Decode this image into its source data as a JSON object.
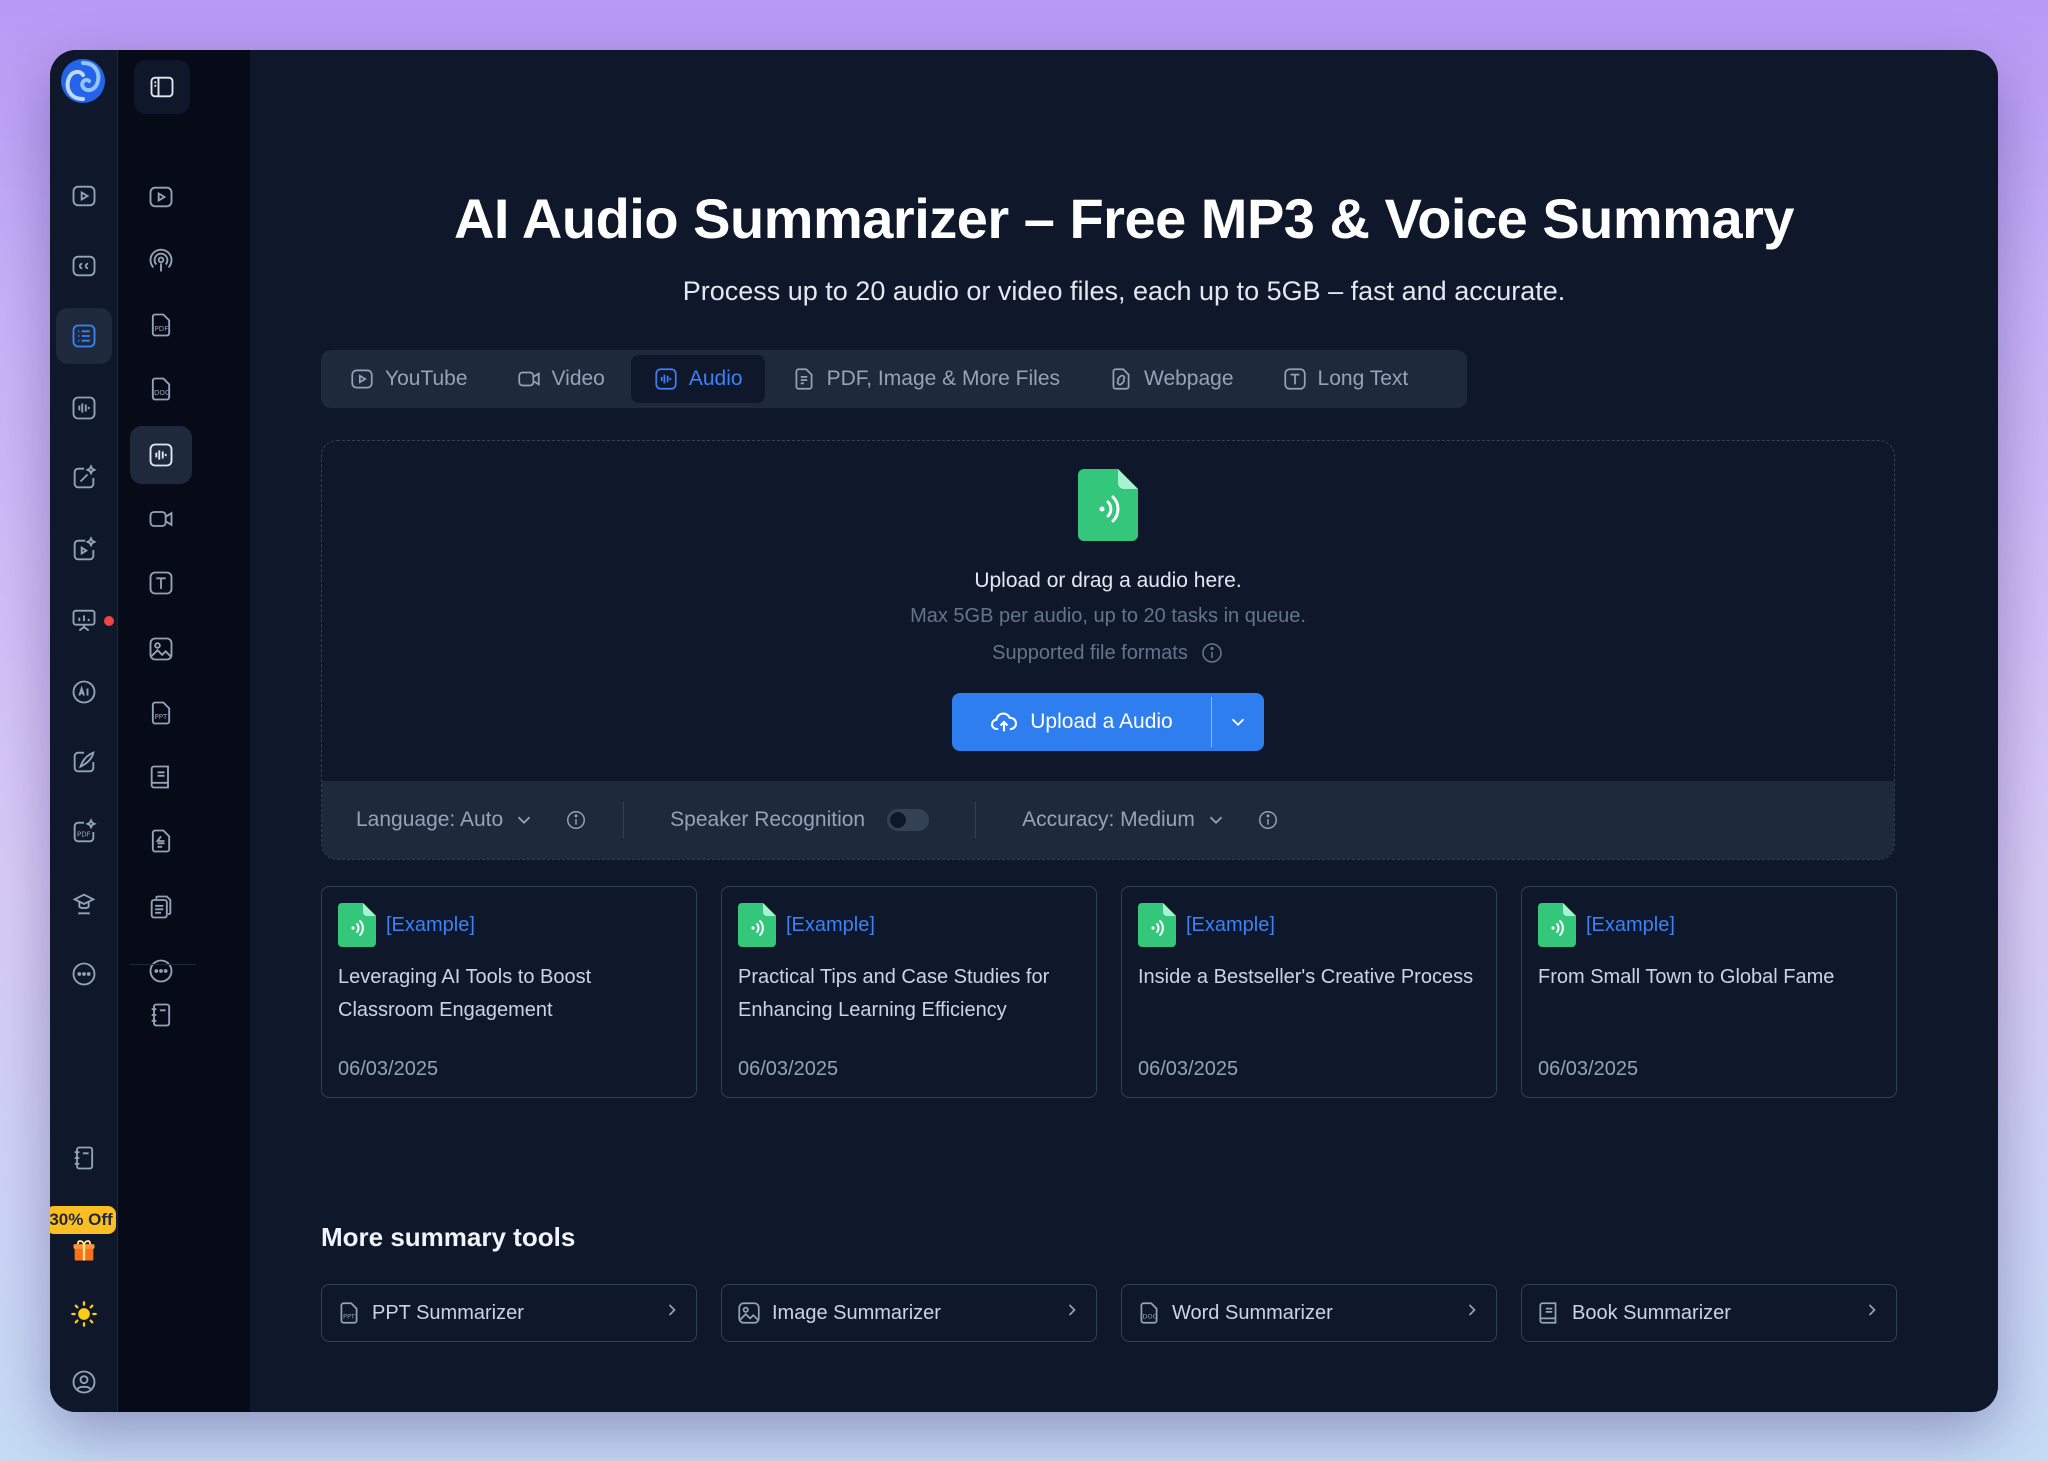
{
  "page": {
    "title": "AI Audio Summarizer – Free MP3 & Voice Summary",
    "subtitle": "Process up to 20 audio or video files, each up to 5GB – fast and accurate."
  },
  "sidebar": {
    "promo_badge": "30% Off"
  },
  "tabs": [
    {
      "label": "YouTube",
      "icon": "youtube-icon"
    },
    {
      "label": "Video",
      "icon": "video-camera-icon"
    },
    {
      "label": "Audio",
      "icon": "audio-wave-icon",
      "active": true
    },
    {
      "label": "PDF, Image & More Files",
      "icon": "file-icon"
    },
    {
      "label": "Webpage",
      "icon": "webpage-icon"
    },
    {
      "label": "Long Text",
      "icon": "text-icon"
    }
  ],
  "upload": {
    "prompt": "Upload or drag a audio here.",
    "limits": "Max 5GB per audio, up to 20 tasks in queue.",
    "formats_label": "Supported file formats",
    "button_label": "Upload a Audio"
  },
  "options": {
    "language": "Language: Auto",
    "speaker": "Speaker Recognition",
    "speaker_enabled": false,
    "accuracy": "Accuracy: Medium"
  },
  "examples": [
    {
      "tag": "[Example]",
      "title": "Leveraging AI Tools to Boost Classroom Engagement",
      "date": "06/03/2025"
    },
    {
      "tag": "[Example]",
      "title": "Practical Tips and Case Studies for Enhancing Learning Efficiency",
      "date": "06/03/2025"
    },
    {
      "tag": "[Example]",
      "title": "Inside a Bestseller's Creative Process",
      "date": "06/03/2025"
    },
    {
      "tag": "[Example]",
      "title": "From Small Town to Global Fame",
      "date": "06/03/2025"
    }
  ],
  "more_tools": {
    "title": "More summary tools",
    "items": [
      {
        "label": "PPT Summarizer",
        "icon": "ppt-icon"
      },
      {
        "label": "Image Summarizer",
        "icon": "image-icon"
      },
      {
        "label": "Word Summarizer",
        "icon": "doc-icon"
      },
      {
        "label": "Book Summarizer",
        "icon": "book-icon"
      }
    ]
  },
  "colors": {
    "accent": "#2f7ef0",
    "background": "#0f172a",
    "file_icon_green": "#34c77b",
    "promo": "#fbbf24"
  }
}
